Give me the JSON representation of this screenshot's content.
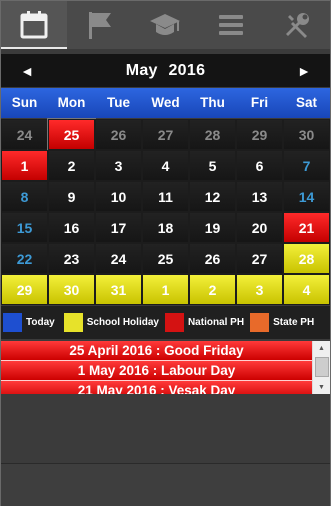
{
  "tabs": [
    {
      "name": "calendar-icon",
      "active": true
    },
    {
      "name": "flag-icon",
      "active": false
    },
    {
      "name": "graduation-cap-icon",
      "active": false
    },
    {
      "name": "menu-icon",
      "active": false
    },
    {
      "name": "tools-icon",
      "active": false
    }
  ],
  "header": {
    "prev_label": "◄",
    "month": "May",
    "year": "2016",
    "next_label": "►"
  },
  "daynames": [
    "Sun",
    "Mon",
    "Tue",
    "Wed",
    "Thu",
    "Fri",
    "Sat"
  ],
  "weeks": [
    [
      "24",
      "25",
      "26",
      "27",
      "28",
      "29",
      "30"
    ],
    [
      "1",
      "2",
      "3",
      "4",
      "5",
      "6",
      "7"
    ],
    [
      "8",
      "9",
      "10",
      "11",
      "12",
      "13",
      "14"
    ],
    [
      "15",
      "16",
      "17",
      "18",
      "19",
      "20",
      "21"
    ],
    [
      "22",
      "23",
      "24",
      "25",
      "26",
      "27",
      "28"
    ],
    [
      "29",
      "30",
      "31",
      "1",
      "2",
      "3",
      "4"
    ]
  ],
  "legend": {
    "today": "Today",
    "school_holiday": "School Holiday",
    "national_ph": "National PH",
    "state_ph": "State PH"
  },
  "holidays": [
    "25 April 2016 : Good Friday",
    "1 May 2016 : Labour Day",
    "21 May 2016 : Vesak Day"
  ],
  "colors": {
    "today": "#1e4fd0",
    "school_holiday": "#e7e22a",
    "national_ph": "#d41212",
    "state_ph": "#e86a2a"
  }
}
